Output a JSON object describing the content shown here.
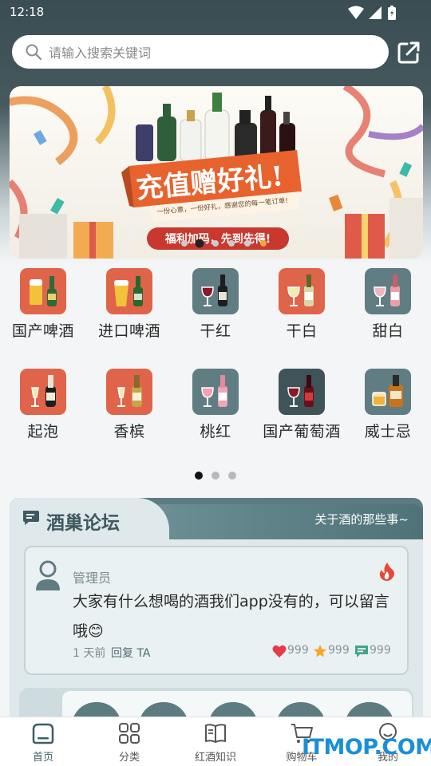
{
  "status_bar": {
    "time": "12:18"
  },
  "search": {
    "placeholder": "请输入搜索关键词"
  },
  "banner": {
    "headline": "充值赠好礼!",
    "subline": "一份心意，一份好礼，感谢您的每一笔订单!",
    "button": "福利加码，先到先得!",
    "accent_color": "#e8622e"
  },
  "categories": [
    {
      "label": "国产啤酒",
      "icon": "domestic-beer-icon",
      "color": "#e0644a"
    },
    {
      "label": "进口啤酒",
      "icon": "imported-beer-icon",
      "color": "#e0644a"
    },
    {
      "label": "干红",
      "icon": "dry-red-wine-icon",
      "color": "#5f7d83"
    },
    {
      "label": "干白",
      "icon": "dry-white-wine-icon",
      "color": "#e0644a"
    },
    {
      "label": "甜白",
      "icon": "sweet-white-wine-icon",
      "color": "#5f7d83"
    },
    {
      "label": "起泡",
      "icon": "sparkling-wine-icon",
      "color": "#e0644a"
    },
    {
      "label": "香槟",
      "icon": "champagne-icon",
      "color": "#e0644a"
    },
    {
      "label": "桃红",
      "icon": "rose-wine-icon",
      "color": "#5f7d83"
    },
    {
      "label": "国产葡萄酒",
      "icon": "domestic-wine-icon",
      "color": "#3f5459"
    },
    {
      "label": "威士忌",
      "icon": "whisky-icon",
      "color": "#5f7d83"
    }
  ],
  "category_pages": {
    "current": 1,
    "total": 3
  },
  "forum": {
    "title": "酒巢论坛",
    "subtitle": "关于酒的那些事~",
    "post": {
      "author": "管理员",
      "text": "大家有什么想喝的酒我们app没有的，可以留言哦😊",
      "time": "1 天前",
      "reply": "回复 TA",
      "likes": "999",
      "favorites": "999",
      "comments": "999"
    }
  },
  "tabbar": {
    "items": [
      {
        "label": "首页",
        "icon": "home-icon",
        "active": true
      },
      {
        "label": "分类",
        "icon": "category-grid-icon",
        "active": false
      },
      {
        "label": "红酒知识",
        "icon": "book-icon",
        "active": false
      },
      {
        "label": "购物车",
        "icon": "cart-icon",
        "active": false
      },
      {
        "label": "我的",
        "icon": "profile-icon",
        "active": false
      }
    ]
  },
  "watermark": "ITMOP.COM",
  "colors": {
    "primary": "#3e5f66",
    "accent": "#e0644a",
    "background": "#f3f5f6"
  }
}
